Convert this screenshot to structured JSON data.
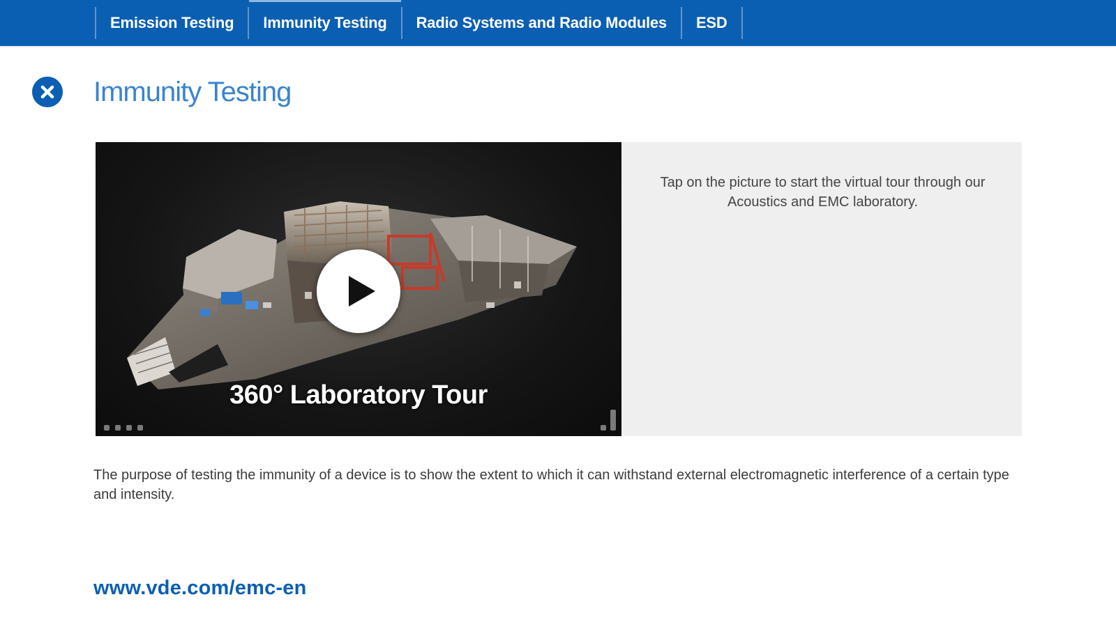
{
  "nav": {
    "tabs": [
      {
        "label": "Emission Testing",
        "active": false
      },
      {
        "label": "Immunity Testing",
        "active": true
      },
      {
        "label": "Radio Systems and Radio Modules",
        "active": false
      },
      {
        "label": "ESD",
        "active": false
      }
    ]
  },
  "page": {
    "title": "Immunity Testing",
    "close_icon": "close-x-icon"
  },
  "media": {
    "video_title": "360° Laboratory Tour",
    "play_icon": "play-icon",
    "hint": "Tap on the picture to start the virtual tour through our Acoustics and EMC laboratory."
  },
  "body": {
    "description": "The purpose of testing the immunity of a device is to show the extent to which it can withstand external electromagnetic interference of a certain type and intensity."
  },
  "footer": {
    "link": "www.vde.com/emc-en"
  },
  "colors": {
    "brand_blue": "#0b5fb3",
    "title_blue": "#3a83d0",
    "panel_grey": "#efefef"
  }
}
